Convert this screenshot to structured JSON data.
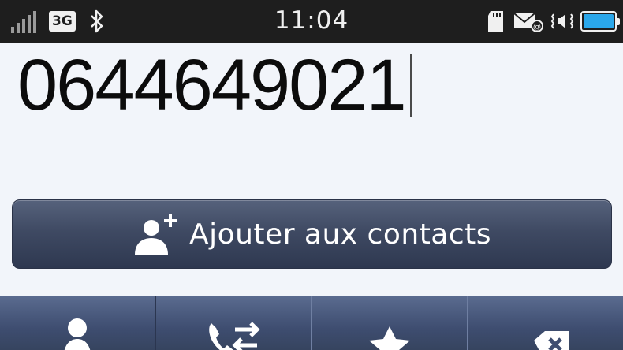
{
  "status_bar": {
    "network_type": "3G",
    "time": "11:04",
    "icons": [
      "signal-icon",
      "bluetooth-icon",
      "sd-card-icon",
      "email-icon",
      "vibrate-icon",
      "battery-icon"
    ],
    "battery_color": "#2aa7ea"
  },
  "dialer": {
    "number": "0644649021"
  },
  "add_contact": {
    "label": "Ajouter aux contacts",
    "icon": "add-contact-icon"
  },
  "toolbar": {
    "items": [
      {
        "icon": "contacts-icon"
      },
      {
        "icon": "call-log-icon"
      },
      {
        "icon": "favorites-star-icon"
      },
      {
        "icon": "backspace-icon"
      }
    ]
  },
  "colors": {
    "status_bar_bg": "#1e1e1e",
    "page_bg": "#f2f5fa",
    "button_bg": "#3f4a63",
    "toolbar_bg": "#4a5a7e"
  }
}
